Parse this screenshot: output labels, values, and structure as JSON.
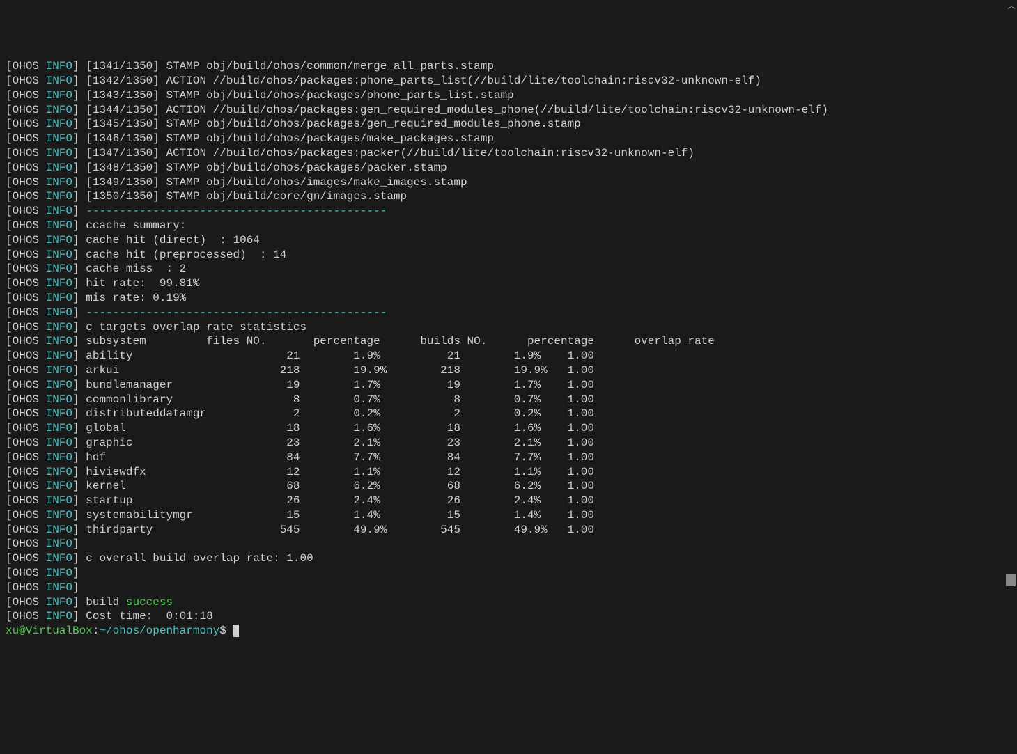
{
  "log_prefix": {
    "open": "[",
    "ohos": "OHOS",
    "space": " ",
    "info": "INFO",
    "close": "]"
  },
  "build_steps": [
    "[1341/1350] STAMP obj/build/ohos/common/merge_all_parts.stamp",
    "[1342/1350] ACTION //build/ohos/packages:phone_parts_list(//build/lite/toolchain:riscv32-unknown-elf)",
    "[1343/1350] STAMP obj/build/ohos/packages/phone_parts_list.stamp",
    "[1344/1350] ACTION //build/ohos/packages:gen_required_modules_phone(//build/lite/toolchain:riscv32-unknown-elf)",
    "[1345/1350] STAMP obj/build/ohos/packages/gen_required_modules_phone.stamp",
    "[1346/1350] STAMP obj/build/ohos/packages/make_packages.stamp",
    "[1347/1350] ACTION //build/ohos/packages:packer(//build/lite/toolchain:riscv32-unknown-elf)",
    "[1348/1350] STAMP obj/build/ohos/packages/packer.stamp",
    "[1349/1350] STAMP obj/build/ohos/images/make_images.stamp",
    "[1350/1350] STAMP obj/build/core/gn/images.stamp"
  ],
  "sep": "---------------------------------------------",
  "ccache": {
    "title": "ccache summary:",
    "direct": "cache hit (direct)  : 1064",
    "preproc": "cache hit (preprocessed)  : 14",
    "miss": "cache miss  : 2",
    "hit_rate": "hit rate:  99.81%",
    "mis_rate": "mis rate: 0.19%"
  },
  "stats_title": "c targets overlap rate statistics",
  "stats_header": "subsystem         files NO.       percentage      builds NO.      percentage      overlap rate",
  "stats_rows": [
    {
      "sub": "ability",
      "fn": "21",
      "p1": "1.9%",
      "bn": "21",
      "p2": "1.9%",
      "or": "1.00"
    },
    {
      "sub": "arkui",
      "fn": "218",
      "p1": "19.9%",
      "bn": "218",
      "p2": "19.9%",
      "or": "1.00"
    },
    {
      "sub": "bundlemanager",
      "fn": "19",
      "p1": "1.7%",
      "bn": "19",
      "p2": "1.7%",
      "or": "1.00"
    },
    {
      "sub": "commonlibrary",
      "fn": "8",
      "p1": "0.7%",
      "bn": "8",
      "p2": "0.7%",
      "or": "1.00"
    },
    {
      "sub": "distributeddatamgr",
      "fn": "2",
      "p1": "0.2%",
      "bn": "2",
      "p2": "0.2%",
      "or": "1.00"
    },
    {
      "sub": "global",
      "fn": "18",
      "p1": "1.6%",
      "bn": "18",
      "p2": "1.6%",
      "or": "1.00"
    },
    {
      "sub": "graphic",
      "fn": "23",
      "p1": "2.1%",
      "bn": "23",
      "p2": "2.1%",
      "or": "1.00"
    },
    {
      "sub": "hdf",
      "fn": "84",
      "p1": "7.7%",
      "bn": "84",
      "p2": "7.7%",
      "or": "1.00"
    },
    {
      "sub": "hiviewdfx",
      "fn": "12",
      "p1": "1.1%",
      "bn": "12",
      "p2": "1.1%",
      "or": "1.00"
    },
    {
      "sub": "kernel",
      "fn": "68",
      "p1": "6.2%",
      "bn": "68",
      "p2": "6.2%",
      "or": "1.00"
    },
    {
      "sub": "startup",
      "fn": "26",
      "p1": "2.4%",
      "bn": "26",
      "p2": "2.4%",
      "or": "1.00"
    },
    {
      "sub": "systemabilitymgr",
      "fn": "15",
      "p1": "1.4%",
      "bn": "15",
      "p2": "1.4%",
      "or": "1.00"
    },
    {
      "sub": "thirdparty",
      "fn": "545",
      "p1": "49.9%",
      "bn": "545",
      "p2": "49.9%",
      "or": "1.00"
    }
  ],
  "overall": "c overall build overlap rate: 1.00",
  "build_pre": " build ",
  "build_success": "success",
  "cost": "Cost time:  0:01:18",
  "prompt": {
    "user": "xu@VirtualBox",
    "sep1": ":",
    "path": "~/ohos/openharmony",
    "dollar": "$ "
  }
}
